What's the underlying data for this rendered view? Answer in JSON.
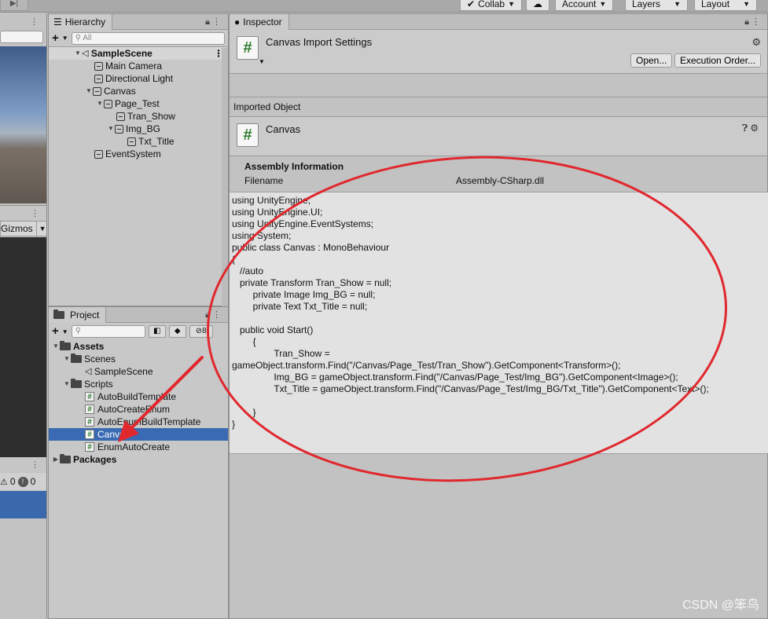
{
  "toolbar": {
    "collab": "Collab",
    "account": "Account",
    "layers": "Layers",
    "layout": "Layout"
  },
  "left": {
    "gizmos": "Gizmos",
    "warn_count": "0",
    "error_count": "0"
  },
  "hierarchy": {
    "tab": "Hierarchy",
    "search_placeholder": "All",
    "scene": "SampleScene",
    "items": [
      "Main Camera",
      "Directional Light",
      "Canvas",
      "Page_Test",
      "Tran_Show",
      "Img_BG",
      "Txt_Title",
      "EventSystem"
    ]
  },
  "project": {
    "tab": "Project",
    "hidden_count": "8",
    "assets": "Assets",
    "scenes": "Scenes",
    "sample_scene": "SampleScene",
    "scripts": "Scripts",
    "files": [
      "AutoBuildTemplate",
      "AutoCreateEnum",
      "AutoEnumBuildTemplate",
      "Canvas",
      "EnumAutoCreate"
    ],
    "packages": "Packages"
  },
  "inspector": {
    "tab": "Inspector",
    "title": "Canvas Import Settings",
    "open_btn": "Open...",
    "exec_btn": "Execution Order...",
    "imported_object": "Imported Object",
    "asset_name": "Canvas",
    "assembly_heading": "Assembly Information",
    "filename_label": "Filename",
    "filename_value": "Assembly-CSharp.dll",
    "code": "using UnityEngine;\nusing UnityEngine.UI;\nusing UnityEngine.EventSystems;\nusing System;\npublic class Canvas : MonoBehaviour\n{\n   //auto\n   private Transform Tran_Show = null;\n\t\tprivate Image Img_BG = null;\n\t\tprivate Text Txt_Title = null;\n\n   public void Start()\n\t\t{\n\t\t\t\tTran_Show =\ngameObject.transform.Find(\"/Canvas/Page_Test/Tran_Show\").GetComponent<Transform>();\n\t\t\t\tImg_BG = gameObject.transform.Find(\"/Canvas/Page_Test/Img_BG\").GetComponent<Image>();\n\t\t\t\tTxt_Title = gameObject.transform.Find(\"/Canvas/Page_Test/Img_BG/Txt_Title\").GetComponent<Text>();\n\n\t\t}\n}"
  },
  "watermark": "CSDN @笨鸟",
  "annotation_color": "#e0282e"
}
